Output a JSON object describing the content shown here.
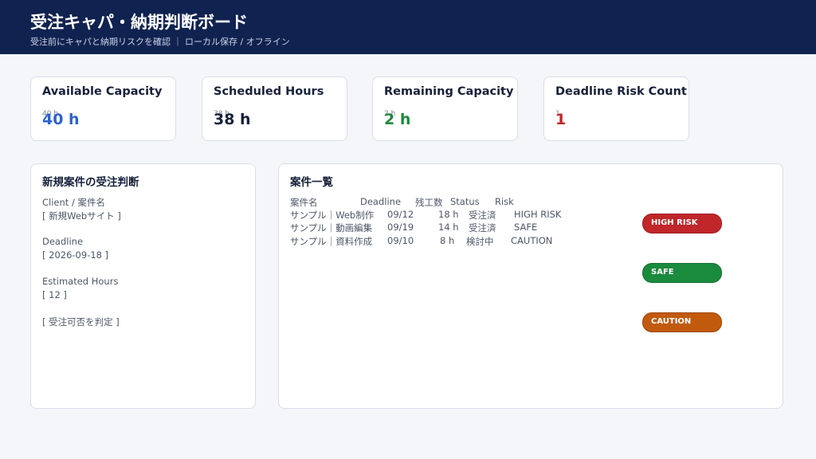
{
  "header": {
    "title": "受注キャパ・納期判断ボード",
    "subtitle": "受注前にキャパと納期リスクを確認 ｜ ローカル保存 / オフライン"
  },
  "colors": {
    "header_bg": "#10224f",
    "blue": "#2c63c9",
    "navy": "#16213a",
    "green": "#1a8a3d",
    "red": "#c0262a",
    "orange": "#c25a0e"
  },
  "kpis": [
    {
      "title": "Available Capacity",
      "small": "40 h",
      "value": "40 h",
      "color": "#2c63c9"
    },
    {
      "title": "Scheduled Hours",
      "small": "38 h",
      "value": "38 h",
      "color": "#16213a"
    },
    {
      "title": "Remaining Capacity",
      "small": "2 h",
      "value": "2 h",
      "color": "#1a8a3d"
    },
    {
      "title": "Deadline Risk Count",
      "small": "1",
      "value": "1",
      "color": "#c0262a"
    }
  ],
  "form": {
    "title": "新規案件の受注判断",
    "client_label": "Client / 案件名",
    "client_value": "[ 新規Webサイト ]",
    "deadline_label": "Deadline",
    "deadline_value": "[ 2026-09-18 ]",
    "hours_label": "Estimated Hours",
    "hours_value": "[ 12 ]",
    "judge_button": "[ 受注可否を判定 ]"
  },
  "projects": {
    "title": "案件一覧",
    "columns": [
      "案件名",
      "Deadline",
      "残工数",
      "Status",
      "Risk"
    ],
    "rows": [
      {
        "name": "サンプル｜Web制作",
        "deadline": "09/12",
        "hours": "18 h",
        "status": "受注済",
        "risk": "HIGH RISK"
      },
      {
        "name": "サンプル｜動画編集",
        "deadline": "09/19",
        "hours": "14 h",
        "status": "受注済",
        "risk": "SAFE"
      },
      {
        "name": "サンプル｜資料作成",
        "deadline": "09/10",
        "hours": "8 h",
        "status": "検討中",
        "risk": "CAUTION"
      }
    ],
    "badges": [
      {
        "label": "HIGH RISK",
        "color": "#c0262a",
        "border": "#9e1c20"
      },
      {
        "label": "SAFE",
        "color": "#1a8a3d",
        "border": "#136e30"
      },
      {
        "label": "CAUTION",
        "color": "#c25a0e",
        "border": "#9c470a"
      }
    ]
  }
}
